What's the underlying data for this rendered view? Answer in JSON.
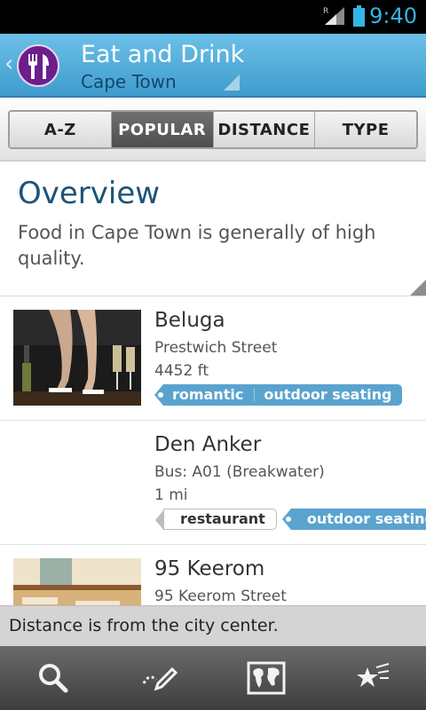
{
  "status": {
    "time": "9:40",
    "signal_badge": "R"
  },
  "header": {
    "title": "Eat and Drink",
    "subtitle": "Cape Town",
    "icon": "fork-knife-icon",
    "colors": {
      "bar": "#4fa9d8",
      "icon_bg": "#6b1e8c"
    }
  },
  "tabs": [
    {
      "label": "A-Z",
      "active": false
    },
    {
      "label": "POPULAR",
      "active": true
    },
    {
      "label": "DISTANCE",
      "active": false
    },
    {
      "label": "TYPE",
      "active": false
    }
  ],
  "overview": {
    "heading": "Overview",
    "text": "Food in Cape Town is generally of high quality."
  },
  "items": [
    {
      "name": "Beluga",
      "line1": "Prestwich Street",
      "line2": "4452 ft",
      "tags": [
        "romantic",
        "outdoor seating"
      ]
    },
    {
      "name": "Den Anker",
      "line1": "Bus: A01 (Breakwater)",
      "line2": "1 mi",
      "tags": [
        "restaurant",
        "outdoor seating"
      ]
    },
    {
      "name": "95 Keerom",
      "line1": "95 Keerom Street",
      "line2": "",
      "tags": []
    }
  ],
  "toast": "Distance is from the city center.",
  "bottom_nav": [
    "search-icon",
    "edit-note-icon",
    "world-map-icon",
    "favorites-stars-icon"
  ]
}
